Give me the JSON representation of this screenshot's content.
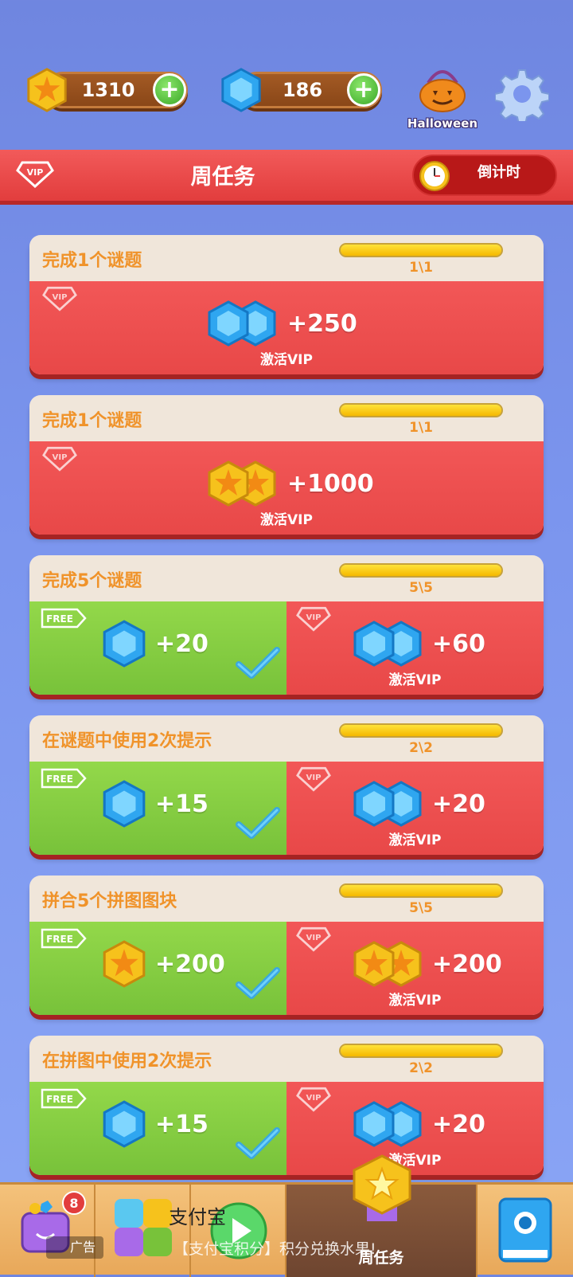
{
  "resources": {
    "coins": "1310",
    "gems": "186"
  },
  "event": {
    "label": "Halloween"
  },
  "header": {
    "title": "周任务",
    "countdown_label": "倒计时"
  },
  "tags": {
    "free": "FREE",
    "vip": "VIP"
  },
  "tasks": [
    {
      "title": "完成1个谜题",
      "progress_text": "1\\1",
      "progress": 1.0,
      "vip": {
        "reward_icon": "gem-pair-icon",
        "amount": "+250",
        "activate": "激活VIP"
      }
    },
    {
      "title": "完成1个谜题",
      "progress_text": "1\\1",
      "progress": 1.0,
      "vip": {
        "reward_icon": "coin-pair-icon",
        "amount": "+1000",
        "activate": "激活VIP"
      }
    },
    {
      "title": "完成5个谜题",
      "progress_text": "5\\5",
      "progress": 1.0,
      "free": {
        "reward_icon": "gem-icon",
        "amount": "+20",
        "claimed": true
      },
      "vip": {
        "reward_icon": "gem-pair-icon",
        "amount": "+60",
        "activate": "激活VIP"
      }
    },
    {
      "title": "在谜题中使用2次提示",
      "progress_text": "2\\2",
      "progress": 1.0,
      "free": {
        "reward_icon": "gem-icon",
        "amount": "+15",
        "claimed": true
      },
      "vip": {
        "reward_icon": "gem-pair-icon",
        "amount": "+20",
        "activate": "激活VIP"
      }
    },
    {
      "title": "拼合5个拼图图块",
      "progress_text": "5\\5",
      "progress": 1.0,
      "free": {
        "reward_icon": "coin-icon",
        "amount": "+200",
        "claimed": true
      },
      "vip": {
        "reward_icon": "coin-pair-icon",
        "amount": "+200",
        "activate": "激活VIP"
      }
    },
    {
      "title": "在拼图中使用2次提示",
      "progress_text": "2\\2",
      "progress": 1.0,
      "free": {
        "reward_icon": "gem-icon",
        "amount": "+15",
        "claimed": true
      },
      "vip": {
        "reward_icon": "gem-pair-icon",
        "amount": "+20",
        "activate": "激活VIP"
      }
    }
  ],
  "bottom_nav": {
    "shop_badge": "8",
    "weekly_label": "周任务"
  },
  "ad": {
    "label": "广告",
    "brand": "支付宝",
    "text": "【支付宝积分】积分兑换水果!"
  },
  "colors": {
    "background": "#7b95ee",
    "vip_red": "#e84848",
    "free_green": "#78c23a",
    "title_orange": "#f0932a"
  }
}
